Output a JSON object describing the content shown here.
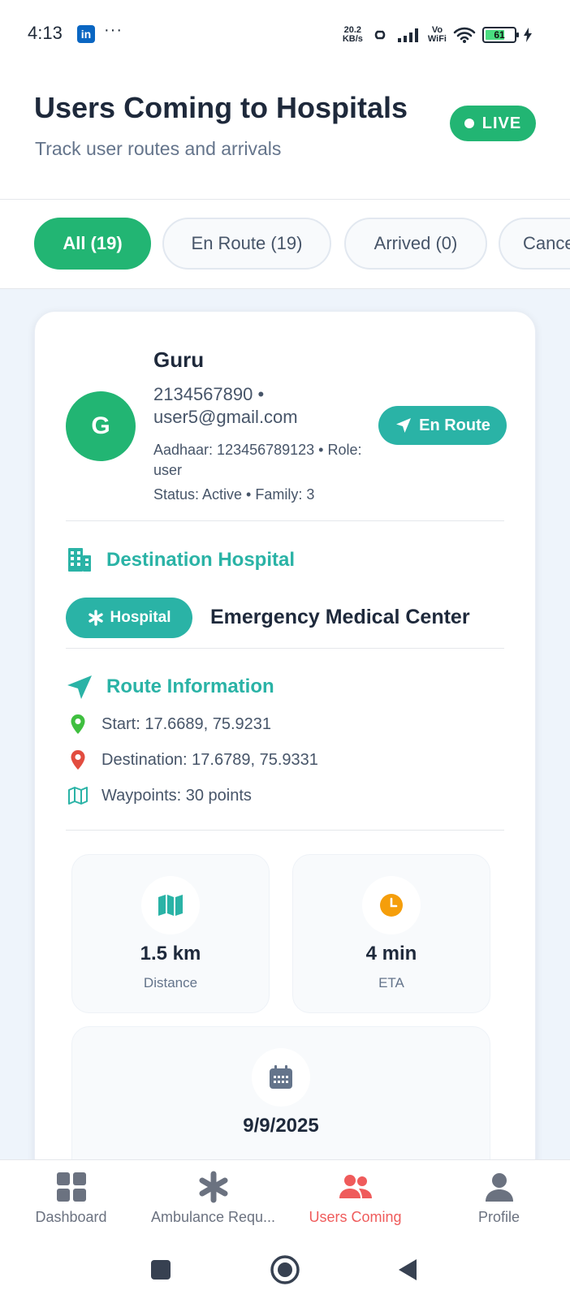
{
  "status_bar": {
    "time": "4:13",
    "app_badge": "in",
    "more": "···",
    "speed_value": "20.2",
    "speed_unit": "KB/s",
    "vo": "Vo",
    "wifi": "WiFi",
    "battery": "61"
  },
  "header": {
    "title": "Users Coming to Hospitals",
    "subtitle": "Track user routes and arrivals",
    "live_label": "LIVE"
  },
  "tabs": [
    {
      "label": "All (19)",
      "active": true
    },
    {
      "label": "En Route (19)",
      "active": false
    },
    {
      "label": "Arrived (0)",
      "active": false
    },
    {
      "label": "Cancelled",
      "active": false
    }
  ],
  "user": {
    "avatar_initial": "G",
    "name": "Guru",
    "contact": "2134567890 • user5@gmail.com",
    "aadhaar_role": "Aadhaar: 123456789123 • Role: user",
    "status_family": "Status: Active • Family: 3",
    "route_status": "En Route"
  },
  "destination": {
    "section_title": "Destination Hospital",
    "type_badge": "Hospital",
    "hospital_name": "Emergency Medical Center"
  },
  "route": {
    "section_title": "Route Information",
    "start": "Start: 17.6689, 75.9231",
    "destination": "Destination: 17.6789, 75.9331",
    "waypoints": "Waypoints: 30 points"
  },
  "stats": {
    "distance_value": "1.5 km",
    "distance_label": "Distance",
    "eta_value": "4 min",
    "eta_label": "ETA",
    "date_value": "9/9/2025"
  },
  "bottom_nav": [
    {
      "label": "Dashboard",
      "icon": "dashboard-icon",
      "active": false
    },
    {
      "label": "Ambulance Requ...",
      "icon": "asterisk-icon",
      "active": false
    },
    {
      "label": "Users Coming",
      "icon": "users-icon",
      "active": true
    },
    {
      "label": "Profile",
      "icon": "person-icon",
      "active": false
    }
  ],
  "colors": {
    "primary_green": "#22b573",
    "teal": "#2ab3a6",
    "active_nav": "#ef5b5b",
    "eta_orange": "#f59e0b"
  }
}
